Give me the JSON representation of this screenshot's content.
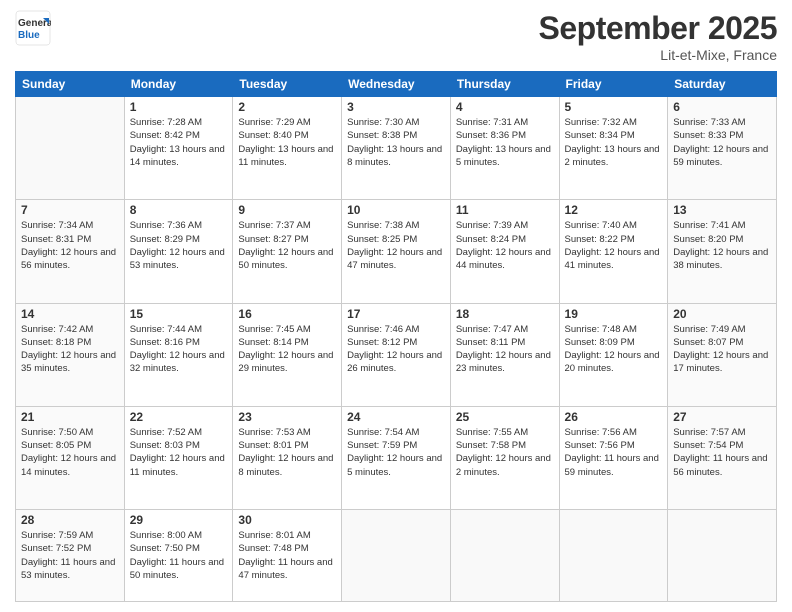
{
  "header": {
    "logo": {
      "line1": "General",
      "line2": "Blue"
    },
    "title": "September 2025",
    "location": "Lit-et-Mixe, France"
  },
  "weekdays": [
    "Sunday",
    "Monday",
    "Tuesday",
    "Wednesday",
    "Thursday",
    "Friday",
    "Saturday"
  ],
  "weeks": [
    [
      {
        "day": "",
        "empty": true
      },
      {
        "day": "1",
        "sunrise": "Sunrise: 7:28 AM",
        "sunset": "Sunset: 8:42 PM",
        "daylight": "Daylight: 13 hours and 14 minutes."
      },
      {
        "day": "2",
        "sunrise": "Sunrise: 7:29 AM",
        "sunset": "Sunset: 8:40 PM",
        "daylight": "Daylight: 13 hours and 11 minutes."
      },
      {
        "day": "3",
        "sunrise": "Sunrise: 7:30 AM",
        "sunset": "Sunset: 8:38 PM",
        "daylight": "Daylight: 13 hours and 8 minutes."
      },
      {
        "day": "4",
        "sunrise": "Sunrise: 7:31 AM",
        "sunset": "Sunset: 8:36 PM",
        "daylight": "Daylight: 13 hours and 5 minutes."
      },
      {
        "day": "5",
        "sunrise": "Sunrise: 7:32 AM",
        "sunset": "Sunset: 8:34 PM",
        "daylight": "Daylight: 13 hours and 2 minutes."
      },
      {
        "day": "6",
        "sunrise": "Sunrise: 7:33 AM",
        "sunset": "Sunset: 8:33 PM",
        "daylight": "Daylight: 12 hours and 59 minutes."
      }
    ],
    [
      {
        "day": "7",
        "sunrise": "Sunrise: 7:34 AM",
        "sunset": "Sunset: 8:31 PM",
        "daylight": "Daylight: 12 hours and 56 minutes."
      },
      {
        "day": "8",
        "sunrise": "Sunrise: 7:36 AM",
        "sunset": "Sunset: 8:29 PM",
        "daylight": "Daylight: 12 hours and 53 minutes."
      },
      {
        "day": "9",
        "sunrise": "Sunrise: 7:37 AM",
        "sunset": "Sunset: 8:27 PM",
        "daylight": "Daylight: 12 hours and 50 minutes."
      },
      {
        "day": "10",
        "sunrise": "Sunrise: 7:38 AM",
        "sunset": "Sunset: 8:25 PM",
        "daylight": "Daylight: 12 hours and 47 minutes."
      },
      {
        "day": "11",
        "sunrise": "Sunrise: 7:39 AM",
        "sunset": "Sunset: 8:24 PM",
        "daylight": "Daylight: 12 hours and 44 minutes."
      },
      {
        "day": "12",
        "sunrise": "Sunrise: 7:40 AM",
        "sunset": "Sunset: 8:22 PM",
        "daylight": "Daylight: 12 hours and 41 minutes."
      },
      {
        "day": "13",
        "sunrise": "Sunrise: 7:41 AM",
        "sunset": "Sunset: 8:20 PM",
        "daylight": "Daylight: 12 hours and 38 minutes."
      }
    ],
    [
      {
        "day": "14",
        "sunrise": "Sunrise: 7:42 AM",
        "sunset": "Sunset: 8:18 PM",
        "daylight": "Daylight: 12 hours and 35 minutes."
      },
      {
        "day": "15",
        "sunrise": "Sunrise: 7:44 AM",
        "sunset": "Sunset: 8:16 PM",
        "daylight": "Daylight: 12 hours and 32 minutes."
      },
      {
        "day": "16",
        "sunrise": "Sunrise: 7:45 AM",
        "sunset": "Sunset: 8:14 PM",
        "daylight": "Daylight: 12 hours and 29 minutes."
      },
      {
        "day": "17",
        "sunrise": "Sunrise: 7:46 AM",
        "sunset": "Sunset: 8:12 PM",
        "daylight": "Daylight: 12 hours and 26 minutes."
      },
      {
        "day": "18",
        "sunrise": "Sunrise: 7:47 AM",
        "sunset": "Sunset: 8:11 PM",
        "daylight": "Daylight: 12 hours and 23 minutes."
      },
      {
        "day": "19",
        "sunrise": "Sunrise: 7:48 AM",
        "sunset": "Sunset: 8:09 PM",
        "daylight": "Daylight: 12 hours and 20 minutes."
      },
      {
        "day": "20",
        "sunrise": "Sunrise: 7:49 AM",
        "sunset": "Sunset: 8:07 PM",
        "daylight": "Daylight: 12 hours and 17 minutes."
      }
    ],
    [
      {
        "day": "21",
        "sunrise": "Sunrise: 7:50 AM",
        "sunset": "Sunset: 8:05 PM",
        "daylight": "Daylight: 12 hours and 14 minutes."
      },
      {
        "day": "22",
        "sunrise": "Sunrise: 7:52 AM",
        "sunset": "Sunset: 8:03 PM",
        "daylight": "Daylight: 12 hours and 11 minutes."
      },
      {
        "day": "23",
        "sunrise": "Sunrise: 7:53 AM",
        "sunset": "Sunset: 8:01 PM",
        "daylight": "Daylight: 12 hours and 8 minutes."
      },
      {
        "day": "24",
        "sunrise": "Sunrise: 7:54 AM",
        "sunset": "Sunset: 7:59 PM",
        "daylight": "Daylight: 12 hours and 5 minutes."
      },
      {
        "day": "25",
        "sunrise": "Sunrise: 7:55 AM",
        "sunset": "Sunset: 7:58 PM",
        "daylight": "Daylight: 12 hours and 2 minutes."
      },
      {
        "day": "26",
        "sunrise": "Sunrise: 7:56 AM",
        "sunset": "Sunset: 7:56 PM",
        "daylight": "Daylight: 11 hours and 59 minutes."
      },
      {
        "day": "27",
        "sunrise": "Sunrise: 7:57 AM",
        "sunset": "Sunset: 7:54 PM",
        "daylight": "Daylight: 11 hours and 56 minutes."
      }
    ],
    [
      {
        "day": "28",
        "sunrise": "Sunrise: 7:59 AM",
        "sunset": "Sunset: 7:52 PM",
        "daylight": "Daylight: 11 hours and 53 minutes."
      },
      {
        "day": "29",
        "sunrise": "Sunrise: 8:00 AM",
        "sunset": "Sunset: 7:50 PM",
        "daylight": "Daylight: 11 hours and 50 minutes."
      },
      {
        "day": "30",
        "sunrise": "Sunrise: 8:01 AM",
        "sunset": "Sunset: 7:48 PM",
        "daylight": "Daylight: 11 hours and 47 minutes."
      },
      {
        "day": "",
        "empty": true
      },
      {
        "day": "",
        "empty": true
      },
      {
        "day": "",
        "empty": true
      },
      {
        "day": "",
        "empty": true
      }
    ]
  ]
}
